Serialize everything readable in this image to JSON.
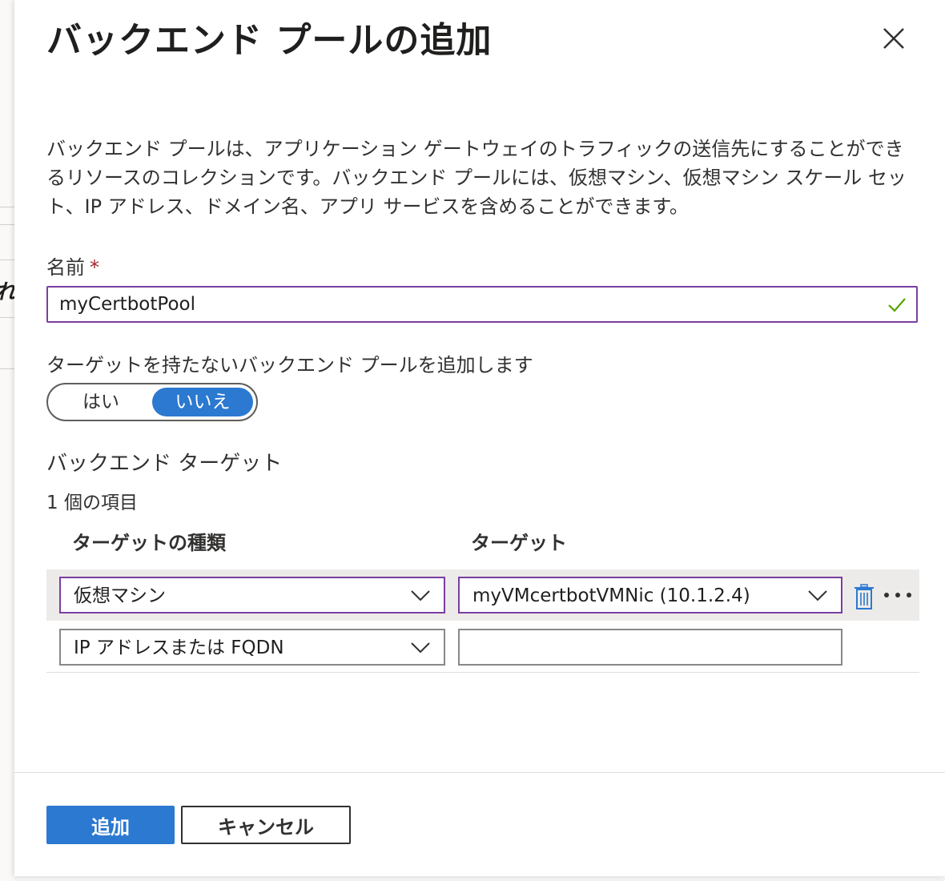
{
  "background": {
    "partial_glyph": "れ"
  },
  "dialog": {
    "title": "バックエンド プールの追加",
    "description": "バックエンド プールは、アプリケーション ゲートウェイのトラフィックの送信先にすることができるリソースのコレクションです。バックエンド プールには、仮想マシン、仮想マシン スケール セット、IP アドレス、ドメイン名、アプリ サービスを含めることができます。"
  },
  "name_field": {
    "label": "名前",
    "required_marker": "*",
    "value": "myCertbotPool",
    "validation_icon": "check-icon"
  },
  "no_targets_toggle": {
    "label": "ターゲットを持たないバックエンド プールを追加します",
    "options": [
      "はい",
      "いいえ"
    ],
    "selected": "いいえ"
  },
  "backend_targets": {
    "title": "バックエンド ターゲット",
    "count_text": "1 個の項目",
    "columns": [
      "ターゲットの種類",
      "ターゲット"
    ],
    "rows": [
      {
        "type": "仮想マシン",
        "target": "myVMcertbotVMNic (10.1.2.4)",
        "actions": [
          "trash-icon",
          "more-icon"
        ]
      },
      {
        "type": "IP アドレスまたは FQDN",
        "target": ""
      }
    ]
  },
  "footer": {
    "add_label": "追加",
    "cancel_label": "キャンセル"
  },
  "colors": {
    "accent": "#2b79d0",
    "focus_border": "#7a3ea1",
    "required": "#a4262c",
    "valid": "#57a300"
  }
}
